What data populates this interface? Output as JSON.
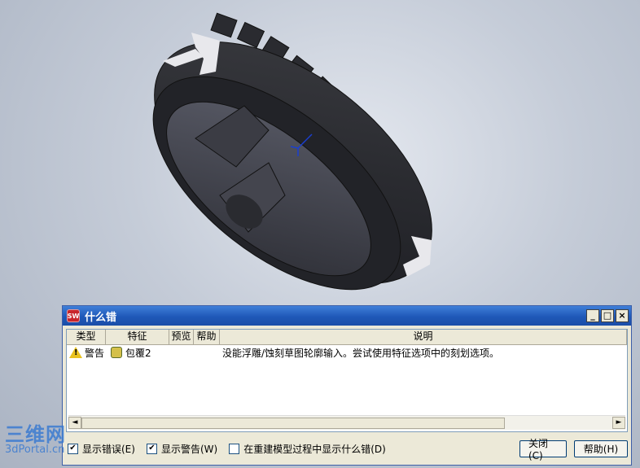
{
  "dialog": {
    "title": "什么错",
    "app_icon_text": "SW",
    "win_min": "_",
    "win_max": "□",
    "win_close": "×",
    "columns": [
      "类型",
      "特征",
      "预览",
      "帮助",
      "说明"
    ],
    "rows": [
      {
        "type": "警告",
        "feature": "包覆2",
        "description": "没能浮雕/蚀刻草图轮廓输入。尝试使用特征选项中的刻划选项。"
      }
    ],
    "scroll_left": "◄",
    "scroll_right": "►",
    "show_errors": {
      "label": "显示错误(E)",
      "checked": true,
      "mark": "✔"
    },
    "show_warnings": {
      "label": "显示警告(W)",
      "checked": true,
      "mark": "✔"
    },
    "show_during_rebuild": {
      "label": "在重建模型过程中显示什么错(D)",
      "checked": false,
      "mark": ""
    },
    "close_button": "关闭(C)",
    "help_button": "帮助(H)"
  },
  "watermark": {
    "line1": "三维网",
    "line2": "3dPortal.cn"
  },
  "colors": {
    "title_bar": "#1f58b8",
    "dialog_bg": "#ece9d8",
    "warning": "#e9c21f"
  },
  "icons": [
    "solidworks-app-icon",
    "warning-icon",
    "feature-wrap-icon"
  ]
}
